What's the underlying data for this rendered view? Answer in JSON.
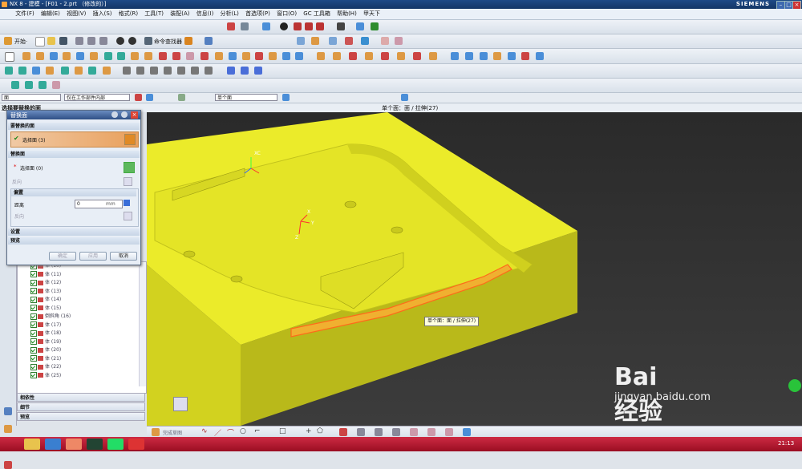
{
  "window": {
    "title": "NX 8 - 建模 - [F01 - 2.prt （修改的）]",
    "brand": "SIEMENS"
  },
  "menu": [
    "文件(F)",
    "编辑(E)",
    "视图(V)",
    "插入(S)",
    "格式(R)",
    "工具(T)",
    "装配(A)",
    "信息(I)",
    "分析(L)",
    "首选项(P)",
    "窗口(O)",
    "GC 工具箱",
    "帮助(H)",
    "甲天下"
  ],
  "toolbar": {
    "start_label": "开始·",
    "command_finder": "命令查找器"
  },
  "selection_bar": {
    "filter": "面",
    "scope": "仅在工作部件内部",
    "face_rule": "单个面"
  },
  "status": {
    "left": "选择要替换的面",
    "center": "单个面：面 / 拉伸(27)"
  },
  "dialog": {
    "title": "替换面",
    "section1": "要替换的面",
    "select1": "选择面 (3)",
    "section2": "替换面",
    "select2": "选择面 (0)",
    "reverse": "反向",
    "offset": "偏置",
    "distance_label": "距离",
    "distance_value": "0",
    "unit": "mm",
    "reverse2": "反向",
    "settings": "设置",
    "preview": "预览",
    "ok": "确定",
    "apply": "应用",
    "cancel": "取消"
  },
  "tree": [
    {
      "label": "体 (10)"
    },
    {
      "label": "体 (11)"
    },
    {
      "label": "体 (12)"
    },
    {
      "label": "体 (13)"
    },
    {
      "label": "体 (14)"
    },
    {
      "label": "体 (15)"
    },
    {
      "label": "倒斜角 (16)"
    },
    {
      "label": "体 (17)"
    },
    {
      "label": "体 (18)"
    },
    {
      "label": "体 (19)"
    },
    {
      "label": "体 (20)"
    },
    {
      "label": "体 (21)"
    },
    {
      "label": "体 (22)"
    },
    {
      "label": "体 (25)"
    }
  ],
  "panels": {
    "dependency": "相依性",
    "details": "细节",
    "preview": "预览"
  },
  "tooltip": "单个面：面 / 拉伸(27)",
  "axis": {
    "xc": "XC",
    "x": "X",
    "y": "Y",
    "z": "Z"
  },
  "bottom_toolbar": {
    "sketch_label": "完成草图"
  },
  "taskbar": {
    "time": "21:13"
  },
  "watermark": {
    "logo": "Bai 经验",
    "url": "jingyan.baidu.com"
  },
  "colors": {
    "part": "#ebeb2a",
    "part_dark": "#b9b91a",
    "highlight": "#ff7a2a",
    "title_bar": "#1b3f77",
    "taskbar": "#b81a30"
  }
}
